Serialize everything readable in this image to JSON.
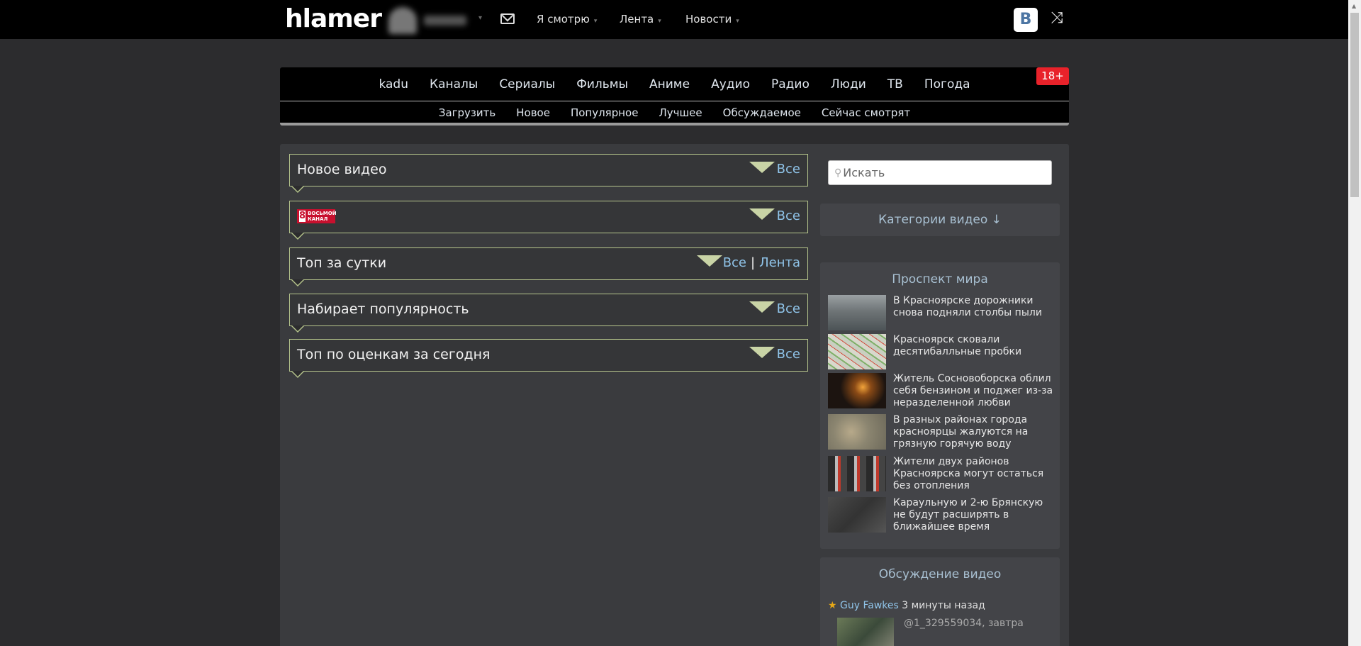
{
  "header": {
    "logo": "hlamer",
    "nav": [
      {
        "label": "Я смотрю"
      },
      {
        "label": "Лента"
      },
      {
        "label": "Новости"
      }
    ],
    "vk_label": "В"
  },
  "categories": {
    "main": [
      "kadu",
      "Каналы",
      "Сериалы",
      "Фильмы",
      "Аниме",
      "Аудио",
      "Радио",
      "Люди",
      "ТВ",
      "Погода"
    ],
    "sub": [
      "Загрузить",
      "Новое",
      "Популярное",
      "Лучшее",
      "Обсуждаемое",
      "Сейчас смотрят"
    ],
    "badge": "18+"
  },
  "sections": [
    {
      "title": "Новое видео",
      "links": [
        "Все"
      ]
    },
    {
      "title": "",
      "logo": {
        "num": "8",
        "line1": "ВОСЬМОЙ",
        "line2": "КАНАЛ"
      },
      "links": [
        "Все"
      ]
    },
    {
      "title": "Топ за сутки",
      "links": [
        "Все",
        "Лента"
      ],
      "sep": "|"
    },
    {
      "title": "Набирает популярность",
      "links": [
        "Все"
      ]
    },
    {
      "title": "Топ по оценкам за сегодня",
      "links": [
        "Все"
      ]
    }
  ],
  "sidebar": {
    "search_placeholder": "Искать",
    "categories_label": "Категории видео ↓",
    "news": {
      "title": "Проспект мира",
      "items": [
        {
          "text": "В Красноярске дорожники снова подняли столбы пыли"
        },
        {
          "text": "Красноярск сковали десятибалльные пробки"
        },
        {
          "text": "Житель Сосновоборска облил себя бензином и поджег из-за неразделенной любви"
        },
        {
          "text": "В разных районах города красноярцы жалуются на грязную горячую воду"
        },
        {
          "text": "Жители двух районов Красноярска могут остаться без отопления"
        },
        {
          "text": "Караульную и 2-ю Брянскую не будут расширять в ближайшее время"
        }
      ]
    },
    "discussion": {
      "title": "Обсуждение видео",
      "star": "★",
      "user": "Guy Fawkes",
      "time": "3 минуты назад",
      "comment": "@1_329559034, завтра"
    }
  }
}
